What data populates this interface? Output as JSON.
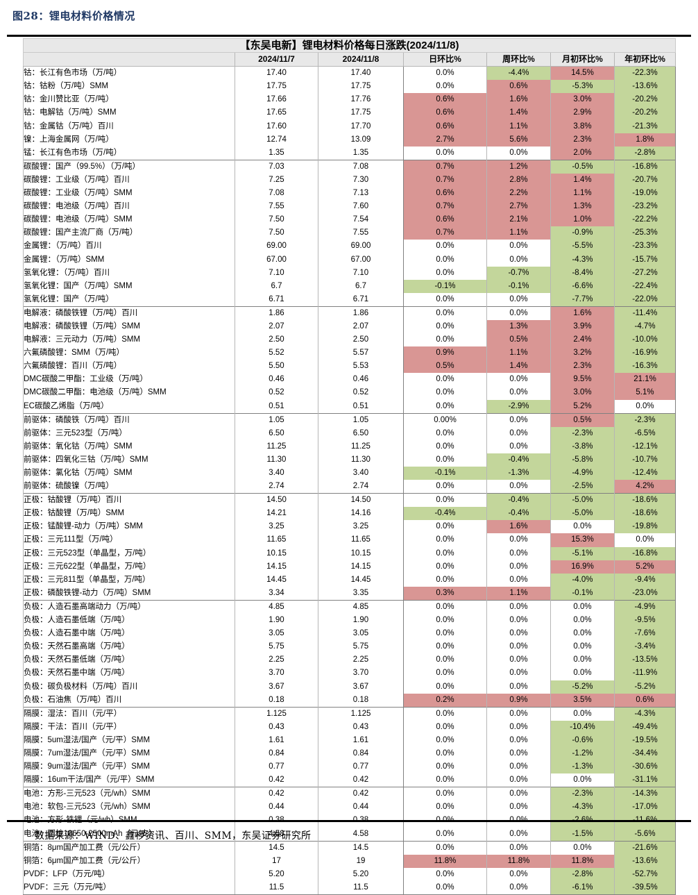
{
  "figure": {
    "label": "图28：锂电材料价格情况",
    "source": "数据来源：WIND、鑫椤资讯、百川、SMM，东吴证券研究所"
  },
  "table": {
    "banner": "【东吴电新】锂电材料价格每日涨跌(2024/11/8)",
    "columns": [
      "",
      "2024/11/7",
      "2024/11/8",
      "日环比%",
      "周环比%",
      "月初环比%",
      "年初环比%"
    ],
    "colors": {
      "green": "#c3d69b",
      "red": "#d99694",
      "white": "#ffffff",
      "header_bg": "#e8e8e8",
      "title_color": "#1f3864"
    },
    "rows": [
      {
        "g": 1,
        "name": "钴：长江有色市场（万/吨）",
        "p1": "17.40",
        "p2": "17.40",
        "d": "0.0%",
        "dc": "w",
        "w": "-4.4%",
        "wc": "g",
        "m": "14.5%",
        "mc": "r",
        "y": "-22.3%",
        "yc": "g"
      },
      {
        "g": 1,
        "name": "钴：钴粉（万/吨）SMM",
        "p1": "17.75",
        "p2": "17.75",
        "d": "0.0%",
        "dc": "w",
        "w": "0.6%",
        "wc": "r",
        "m": "-5.3%",
        "mc": "g",
        "y": "-13.6%",
        "yc": "g"
      },
      {
        "g": 1,
        "name": "钴：金川赞比亚（万/吨）",
        "p1": "17.66",
        "p2": "17.76",
        "d": "0.6%",
        "dc": "r",
        "w": "1.6%",
        "wc": "r",
        "m": "3.0%",
        "mc": "r",
        "y": "-20.2%",
        "yc": "g"
      },
      {
        "g": 1,
        "name": "钴：电解钴（万/吨）SMM",
        "p1": "17.65",
        "p2": "17.75",
        "d": "0.6%",
        "dc": "r",
        "w": "1.4%",
        "wc": "r",
        "m": "2.9%",
        "mc": "r",
        "y": "-20.2%",
        "yc": "g"
      },
      {
        "g": 1,
        "name": "钴：金属钴（万/吨）百川",
        "p1": "17.60",
        "p2": "17.70",
        "d": "0.6%",
        "dc": "r",
        "w": "1.1%",
        "wc": "r",
        "m": "3.8%",
        "mc": "r",
        "y": "-21.3%",
        "yc": "g"
      },
      {
        "g": 1,
        "name": "镍：上海金属网（万/吨）",
        "p1": "12.74",
        "p2": "13.09",
        "d": "2.7%",
        "dc": "r",
        "w": "5.6%",
        "wc": "r",
        "m": "2.3%",
        "mc": "r",
        "y": "1.8%",
        "yc": "r"
      },
      {
        "g": 1,
        "name": "锰：长江有色市场（万/吨）",
        "p1": "1.35",
        "p2": "1.35",
        "d": "0.0%",
        "dc": "w",
        "w": "0.0%",
        "wc": "w",
        "m": "2.0%",
        "mc": "r",
        "y": "-2.8%",
        "yc": "g"
      },
      {
        "g": 2,
        "name": "碳酸锂：国产（99.5%）（万/吨）",
        "p1": "7.03",
        "p2": "7.08",
        "d": "0.7%",
        "dc": "r",
        "w": "1.2%",
        "wc": "r",
        "m": "-0.5%",
        "mc": "g",
        "y": "-16.8%",
        "yc": "g"
      },
      {
        "g": 2,
        "name": "碳酸锂：工业级（万/吨）百川",
        "p1": "7.25",
        "p2": "7.30",
        "d": "0.7%",
        "dc": "r",
        "w": "2.8%",
        "wc": "r",
        "m": "1.4%",
        "mc": "r",
        "y": "-20.7%",
        "yc": "g"
      },
      {
        "g": 2,
        "name": "碳酸锂：工业级（万/吨）SMM",
        "p1": "7.08",
        "p2": "7.13",
        "d": "0.6%",
        "dc": "r",
        "w": "2.2%",
        "wc": "r",
        "m": "1.1%",
        "mc": "r",
        "y": "-19.0%",
        "yc": "g"
      },
      {
        "g": 2,
        "name": "碳酸锂：电池级（万/吨）百川",
        "p1": "7.55",
        "p2": "7.60",
        "d": "0.7%",
        "dc": "r",
        "w": "2.7%",
        "wc": "r",
        "m": "1.3%",
        "mc": "r",
        "y": "-23.2%",
        "yc": "g"
      },
      {
        "g": 2,
        "name": "碳酸锂：电池级（万/吨）SMM",
        "p1": "7.50",
        "p2": "7.54",
        "d": "0.6%",
        "dc": "r",
        "w": "2.1%",
        "wc": "r",
        "m": "1.0%",
        "mc": "r",
        "y": "-22.2%",
        "yc": "g"
      },
      {
        "g": 2,
        "name": "碳酸锂：国产主流厂商（万/吨）",
        "p1": "7.50",
        "p2": "7.55",
        "d": "0.7%",
        "dc": "r",
        "w": "1.1%",
        "wc": "r",
        "m": "-0.9%",
        "mc": "g",
        "y": "-25.3%",
        "yc": "g"
      },
      {
        "g": 2,
        "name": "金属锂：（万/吨）百川",
        "p1": "69.00",
        "p2": "69.00",
        "d": "0.0%",
        "dc": "w",
        "w": "0.0%",
        "wc": "w",
        "m": "-5.5%",
        "mc": "g",
        "y": "-23.3%",
        "yc": "g"
      },
      {
        "g": 2,
        "name": "金属锂：（万/吨）SMM",
        "p1": "67.00",
        "p2": "67.00",
        "d": "0.0%",
        "dc": "w",
        "w": "0.0%",
        "wc": "w",
        "m": "-4.3%",
        "mc": "g",
        "y": "-15.7%",
        "yc": "g"
      },
      {
        "g": 2,
        "name": "氢氧化锂：（万/吨）百川",
        "p1": "7.10",
        "p2": "7.10",
        "d": "0.0%",
        "dc": "w",
        "w": "-0.7%",
        "wc": "g",
        "m": "-8.4%",
        "mc": "g",
        "y": "-27.2%",
        "yc": "g"
      },
      {
        "g": 2,
        "name": "氢氧化锂：国产（万/吨）SMM",
        "p1": "6.7",
        "p2": "6.7",
        "d": "-0.1%",
        "dc": "g",
        "w": "-0.1%",
        "wc": "g",
        "m": "-6.6%",
        "mc": "g",
        "y": "-22.4%",
        "yc": "g"
      },
      {
        "g": 2,
        "name": "氢氧化锂：国产（万/吨）",
        "p1": "6.71",
        "p2": "6.71",
        "d": "0.0%",
        "dc": "w",
        "w": "0.0%",
        "wc": "w",
        "m": "-7.7%",
        "mc": "g",
        "y": "-22.0%",
        "yc": "g"
      },
      {
        "g": 3,
        "name": "电解液：磷酸铁锂（万/吨）百川",
        "p1": "1.86",
        "p2": "1.86",
        "d": "0.0%",
        "dc": "w",
        "w": "0.0%",
        "wc": "w",
        "m": "1.6%",
        "mc": "r",
        "y": "-11.4%",
        "yc": "g"
      },
      {
        "g": 3,
        "name": "电解液：磷酸铁锂（万/吨）SMM",
        "p1": "2.07",
        "p2": "2.07",
        "d": "0.0%",
        "dc": "w",
        "w": "1.3%",
        "wc": "r",
        "m": "3.9%",
        "mc": "r",
        "y": "-4.7%",
        "yc": "g"
      },
      {
        "g": 3,
        "name": "电解液：三元动力（万/吨）SMM",
        "p1": "2.50",
        "p2": "2.50",
        "d": "0.0%",
        "dc": "w",
        "w": "0.5%",
        "wc": "r",
        "m": "2.4%",
        "mc": "r",
        "y": "-10.0%",
        "yc": "g"
      },
      {
        "g": 3,
        "name": "六氟磷酸锂：SMM（万/吨）",
        "p1": "5.52",
        "p2": "5.57",
        "d": "0.9%",
        "dc": "r",
        "w": "1.1%",
        "wc": "r",
        "m": "3.2%",
        "mc": "r",
        "y": "-16.9%",
        "yc": "g"
      },
      {
        "g": 3,
        "name": "六氟磷酸锂：百川（万/吨）",
        "p1": "5.50",
        "p2": "5.53",
        "d": "0.5%",
        "dc": "r",
        "w": "1.4%",
        "wc": "r",
        "m": "2.3%",
        "mc": "r",
        "y": "-16.3%",
        "yc": "g"
      },
      {
        "g": 3,
        "name": "DMC碳酸二甲酯：工业级（万/吨）",
        "p1": "0.46",
        "p2": "0.46",
        "d": "0.0%",
        "dc": "w",
        "w": "0.0%",
        "wc": "w",
        "m": "9.5%",
        "mc": "r",
        "y": "21.1%",
        "yc": "r"
      },
      {
        "g": 3,
        "name": "DMC碳酸二甲酯：电池级（万/吨）SMM",
        "p1": "0.52",
        "p2": "0.52",
        "d": "0.0%",
        "dc": "w",
        "w": "0.0%",
        "wc": "w",
        "m": "3.0%",
        "mc": "r",
        "y": "5.1%",
        "yc": "r"
      },
      {
        "g": 3,
        "name": "EC碳酸乙烯脂（万/吨）",
        "p1": "0.51",
        "p2": "0.51",
        "d": "0.0%",
        "dc": "w",
        "w": "-2.9%",
        "wc": "g",
        "m": "5.2%",
        "mc": "r",
        "y": "0.0%",
        "yc": "w"
      },
      {
        "g": 4,
        "name": "前驱体：磷酸铁（万/吨）百川",
        "p1": "1.05",
        "p2": "1.05",
        "d": "0.00%",
        "dc": "w",
        "w": "0.0%",
        "wc": "w",
        "m": "0.5%",
        "mc": "r",
        "y": "-2.3%",
        "yc": "g"
      },
      {
        "g": 4,
        "name": "前驱体：三元523型（万/吨）",
        "p1": "6.50",
        "p2": "6.50",
        "d": "0.0%",
        "dc": "w",
        "w": "0.0%",
        "wc": "w",
        "m": "-2.3%",
        "mc": "g",
        "y": "-6.5%",
        "yc": "g"
      },
      {
        "g": 4,
        "name": "前驱体：氧化钴（万/吨）SMM",
        "p1": "11.25",
        "p2": "11.25",
        "d": "0.0%",
        "dc": "w",
        "w": "0.0%",
        "wc": "w",
        "m": "-3.8%",
        "mc": "g",
        "y": "-12.1%",
        "yc": "g"
      },
      {
        "g": 4,
        "name": "前驱体：四氧化三钴（万/吨）SMM",
        "p1": "11.30",
        "p2": "11.30",
        "d": "0.0%",
        "dc": "w",
        "w": "-0.4%",
        "wc": "g",
        "m": "-5.8%",
        "mc": "g",
        "y": "-10.7%",
        "yc": "g"
      },
      {
        "g": 4,
        "name": "前驱体：氯化钴（万/吨）SMM",
        "p1": "3.40",
        "p2": "3.40",
        "d": "-0.1%",
        "dc": "g",
        "w": "-1.3%",
        "wc": "g",
        "m": "-4.9%",
        "mc": "g",
        "y": "-12.4%",
        "yc": "g"
      },
      {
        "g": 4,
        "name": "前驱体：硫酸镍（万/吨）",
        "p1": "2.74",
        "p2": "2.74",
        "d": "0.0%",
        "dc": "w",
        "w": "0.0%",
        "wc": "w",
        "m": "-2.5%",
        "mc": "g",
        "y": "4.2%",
        "yc": "r"
      },
      {
        "g": 5,
        "name": "正极：钴酸锂（万/吨）百川",
        "p1": "14.50",
        "p2": "14.50",
        "d": "0.0%",
        "dc": "w",
        "w": "-0.4%",
        "wc": "g",
        "m": "-5.0%",
        "mc": "g",
        "y": "-18.6%",
        "yc": "g"
      },
      {
        "g": 5,
        "name": "正极：钴酸锂（万/吨）SMM",
        "p1": "14.21",
        "p2": "14.16",
        "d": "-0.4%",
        "dc": "g",
        "w": "-0.4%",
        "wc": "g",
        "m": "-5.0%",
        "mc": "g",
        "y": "-18.6%",
        "yc": "g"
      },
      {
        "g": 5,
        "name": "正极：锰酸锂-动力（万/吨）SMM",
        "p1": "3.25",
        "p2": "3.25",
        "d": "0.0%",
        "dc": "w",
        "w": "1.6%",
        "wc": "r",
        "m": "0.0%",
        "mc": "w",
        "y": "-19.8%",
        "yc": "g"
      },
      {
        "g": 5,
        "name": "正极：三元111型（万/吨）",
        "p1": "11.65",
        "p2": "11.65",
        "d": "0.0%",
        "dc": "w",
        "w": "0.0%",
        "wc": "w",
        "m": "15.3%",
        "mc": "r",
        "y": "0.0%",
        "yc": "w"
      },
      {
        "g": 5,
        "name": "正极：三元523型（单晶型，万/吨）",
        "p1": "10.15",
        "p2": "10.15",
        "d": "0.0%",
        "dc": "w",
        "w": "0.0%",
        "wc": "w",
        "m": "-5.1%",
        "mc": "g",
        "y": "-16.8%",
        "yc": "g"
      },
      {
        "g": 5,
        "name": "正极：三元622型（单晶型，万/吨）",
        "p1": "14.15",
        "p2": "14.15",
        "d": "0.0%",
        "dc": "w",
        "w": "0.0%",
        "wc": "w",
        "m": "16.9%",
        "mc": "r",
        "y": "5.2%",
        "yc": "r"
      },
      {
        "g": 5,
        "name": "正极：三元811型（单晶型，万/吨）",
        "p1": "14.45",
        "p2": "14.45",
        "d": "0.0%",
        "dc": "w",
        "w": "0.0%",
        "wc": "w",
        "m": "-4.0%",
        "mc": "g",
        "y": "-9.4%",
        "yc": "g"
      },
      {
        "g": 5,
        "name": "正极：磷酸铁锂-动力（万/吨）SMM",
        "p1": "3.34",
        "p2": "3.35",
        "d": "0.3%",
        "dc": "r",
        "w": "1.1%",
        "wc": "r",
        "m": "-0.1%",
        "mc": "g",
        "y": "-23.0%",
        "yc": "g"
      },
      {
        "g": 6,
        "name": "负极：人造石墨高端动力（万/吨）",
        "p1": "4.85",
        "p2": "4.85",
        "d": "0.0%",
        "dc": "w",
        "w": "0.0%",
        "wc": "w",
        "m": "0.0%",
        "mc": "w",
        "y": "-4.9%",
        "yc": "g"
      },
      {
        "g": 6,
        "name": "负极：人造石墨低端（万/吨）",
        "p1": "1.90",
        "p2": "1.90",
        "d": "0.0%",
        "dc": "w",
        "w": "0.0%",
        "wc": "w",
        "m": "0.0%",
        "mc": "w",
        "y": "-9.5%",
        "yc": "g"
      },
      {
        "g": 6,
        "name": "负极：人造石墨中端（万/吨）",
        "p1": "3.05",
        "p2": "3.05",
        "d": "0.0%",
        "dc": "w",
        "w": "0.0%",
        "wc": "w",
        "m": "0.0%",
        "mc": "w",
        "y": "-7.6%",
        "yc": "g"
      },
      {
        "g": 6,
        "name": "负极：天然石墨高端（万/吨）",
        "p1": "5.75",
        "p2": "5.75",
        "d": "0.0%",
        "dc": "w",
        "w": "0.0%",
        "wc": "w",
        "m": "0.0%",
        "mc": "w",
        "y": "-3.4%",
        "yc": "g"
      },
      {
        "g": 6,
        "name": "负极：天然石墨低端（万/吨）",
        "p1": "2.25",
        "p2": "2.25",
        "d": "0.0%",
        "dc": "w",
        "w": "0.0%",
        "wc": "w",
        "m": "0.0%",
        "mc": "w",
        "y": "-13.5%",
        "yc": "g"
      },
      {
        "g": 6,
        "name": "负极：天然石墨中端（万/吨）",
        "p1": "3.70",
        "p2": "3.70",
        "d": "0.0%",
        "dc": "w",
        "w": "0.0%",
        "wc": "w",
        "m": "0.0%",
        "mc": "w",
        "y": "-11.9%",
        "yc": "g"
      },
      {
        "g": 6,
        "name": "负极：碳负极材料（万/吨）百川",
        "p1": "3.67",
        "p2": "3.67",
        "d": "0.0%",
        "dc": "w",
        "w": "0.0%",
        "wc": "w",
        "m": "-5.2%",
        "mc": "g",
        "y": "-5.2%",
        "yc": "g"
      },
      {
        "g": 6,
        "name": "负极：石油焦（万/吨）百川",
        "p1": "0.18",
        "p2": "0.18",
        "d": "0.2%",
        "dc": "r",
        "w": "0.9%",
        "wc": "r",
        "m": "3.5%",
        "mc": "r",
        "y": "0.6%",
        "yc": "r"
      },
      {
        "g": 7,
        "name": "隔膜：湿法：百川（元/平）",
        "p1": "1.125",
        "p2": "1.125",
        "d": "0.0%",
        "dc": "w",
        "w": "0.0%",
        "wc": "w",
        "m": "0.0%",
        "mc": "w",
        "y": "-4.3%",
        "yc": "g"
      },
      {
        "g": 7,
        "name": "隔膜：干法：百川（元/平）",
        "p1": "0.43",
        "p2": "0.43",
        "d": "0.0%",
        "dc": "w",
        "w": "0.0%",
        "wc": "w",
        "m": "-10.4%",
        "mc": "g",
        "y": "-49.4%",
        "yc": "g"
      },
      {
        "g": 7,
        "name": "隔膜：5um湿法/国产（元/平）SMM",
        "p1": "1.61",
        "p2": "1.61",
        "d": "0.0%",
        "dc": "w",
        "w": "0.0%",
        "wc": "w",
        "m": "-0.6%",
        "mc": "g",
        "y": "-19.5%",
        "yc": "g"
      },
      {
        "g": 7,
        "name": "隔膜：7um湿法/国产（元/平）SMM",
        "p1": "0.84",
        "p2": "0.84",
        "d": "0.0%",
        "dc": "w",
        "w": "0.0%",
        "wc": "w",
        "m": "-1.2%",
        "mc": "g",
        "y": "-34.4%",
        "yc": "g"
      },
      {
        "g": 7,
        "name": "隔膜：9um湿法/国产（元/平）SMM",
        "p1": "0.77",
        "p2": "0.77",
        "d": "0.0%",
        "dc": "w",
        "w": "0.0%",
        "wc": "w",
        "m": "-1.3%",
        "mc": "g",
        "y": "-30.6%",
        "yc": "g"
      },
      {
        "g": 7,
        "name": "隔膜：16um干法/国产（元/平）SMM",
        "p1": "0.42",
        "p2": "0.42",
        "d": "0.0%",
        "dc": "w",
        "w": "0.0%",
        "wc": "w",
        "m": "0.0%",
        "mc": "w",
        "y": "-31.1%",
        "yc": "g"
      },
      {
        "g": 8,
        "name": "电池：方形-三元523（元/wh）SMM",
        "p1": "0.42",
        "p2": "0.42",
        "d": "0.0%",
        "dc": "w",
        "w": "0.0%",
        "wc": "w",
        "m": "-2.3%",
        "mc": "g",
        "y": "-14.3%",
        "yc": "g"
      },
      {
        "g": 8,
        "name": "电池：软包-三元523（元/wh）SMM",
        "p1": "0.44",
        "p2": "0.44",
        "d": "0.0%",
        "dc": "w",
        "w": "0.0%",
        "wc": "w",
        "m": "-4.3%",
        "mc": "g",
        "y": "-17.0%",
        "yc": "g"
      },
      {
        "g": 8,
        "name": "电池：方形-铁锂（元/wh）SMM",
        "p1": "0.38",
        "p2": "0.38",
        "d": "0.0%",
        "dc": "w",
        "w": "0.0%",
        "wc": "w",
        "m": "-2.6%",
        "mc": "g",
        "y": "-11.6%",
        "yc": "g"
      },
      {
        "g": 8,
        "name": "电池：圆柱18650-2500mAh（元/支）",
        "p1": "4.58",
        "p2": "4.58",
        "d": "0.0%",
        "dc": "w",
        "w": "0.0%",
        "wc": "w",
        "m": "-1.5%",
        "mc": "g",
        "y": "-5.6%",
        "yc": "g"
      },
      {
        "g": 9,
        "name": "铜箔：8μm国产加工费（元/公斤）",
        "p1": "14.5",
        "p2": "14.5",
        "d": "0.0%",
        "dc": "w",
        "w": "0.0%",
        "wc": "w",
        "m": "0.0%",
        "mc": "w",
        "y": "-21.6%",
        "yc": "g"
      },
      {
        "g": 9,
        "name": "铜箔：6μm国产加工费（元/公斤）",
        "p1": "17",
        "p2": "19",
        "d": "11.8%",
        "dc": "r",
        "w": "11.8%",
        "wc": "r",
        "m": "11.8%",
        "mc": "r",
        "y": "-13.6%",
        "yc": "g"
      },
      {
        "g": 9,
        "name": "PVDF：LFP（万元/吨）",
        "p1": "5.20",
        "p2": "5.20",
        "d": "0.0%",
        "dc": "w",
        "w": "0.0%",
        "wc": "w",
        "m": "-2.8%",
        "mc": "g",
        "y": "-52.7%",
        "yc": "g"
      },
      {
        "g": 9,
        "name": "PVDF：三元（万元/吨）",
        "p1": "11.5",
        "p2": "11.5",
        "d": "0.0%",
        "dc": "w",
        "w": "0.0%",
        "wc": "w",
        "m": "-6.1%",
        "mc": "g",
        "y": "-39.5%",
        "yc": "g"
      }
    ]
  }
}
